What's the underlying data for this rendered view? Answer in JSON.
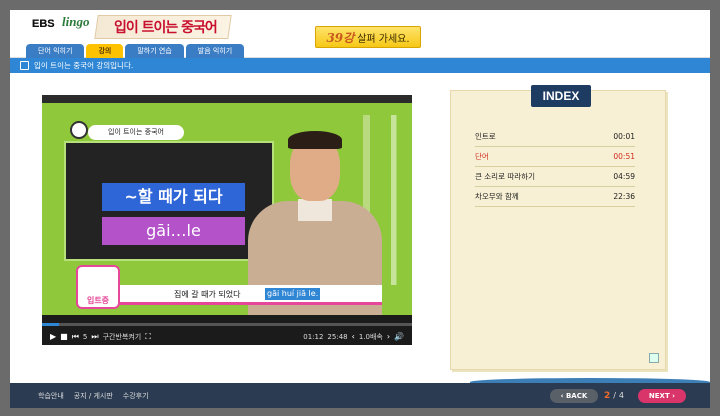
{
  "logo": {
    "brand": "EBS",
    "brand_script": "lingo",
    "title": "입이 트이는 중국어"
  },
  "tabs": [
    {
      "label": "단어 익히기"
    },
    {
      "label": "강의"
    },
    {
      "label": "말하기 연습"
    },
    {
      "label": "발음 익히기"
    }
  ],
  "lecture": {
    "number": "39강",
    "name": "살펴 가세요."
  },
  "subbar": {
    "text": "입이 트이는 중국어 강의입니다."
  },
  "video": {
    "board_label": "입이 트이는 중국어",
    "board_korean": "~할 때가 되다",
    "board_pinyin": "gāi…le",
    "subtitle_korean": "집에 갈 때가 되었다",
    "subtitle_pinyin": "gāi huí jiā le.",
    "mascot_label": "입트중"
  },
  "player": {
    "progress": 0.047,
    "rewind_steps": "5",
    "repeat_label": "구간반복켜기",
    "current_time": "01:12",
    "total_time": "25:48",
    "speed": "1.0배속"
  },
  "index": {
    "title": "INDEX",
    "items": [
      {
        "label": "인트로",
        "time": "00:01"
      },
      {
        "label": "단어",
        "time": "00:51"
      },
      {
        "label": "큰 소리로 따라하기",
        "time": "04:59"
      },
      {
        "label": "차오무와 함께",
        "time": "22:36"
      }
    ]
  },
  "footer": {
    "links": [
      "학습안내",
      "공지 / 게시판",
      "수강후기"
    ],
    "back_label": "BACK",
    "page_current": "2",
    "page_separator": "/",
    "page_total": "4",
    "next_label": "NEXT"
  },
  "colors": {
    "accent_blue": "#2f86d4",
    "tab_active": "#ffc200",
    "index_current": "#d2291f",
    "next_pink": "#d9356a"
  }
}
